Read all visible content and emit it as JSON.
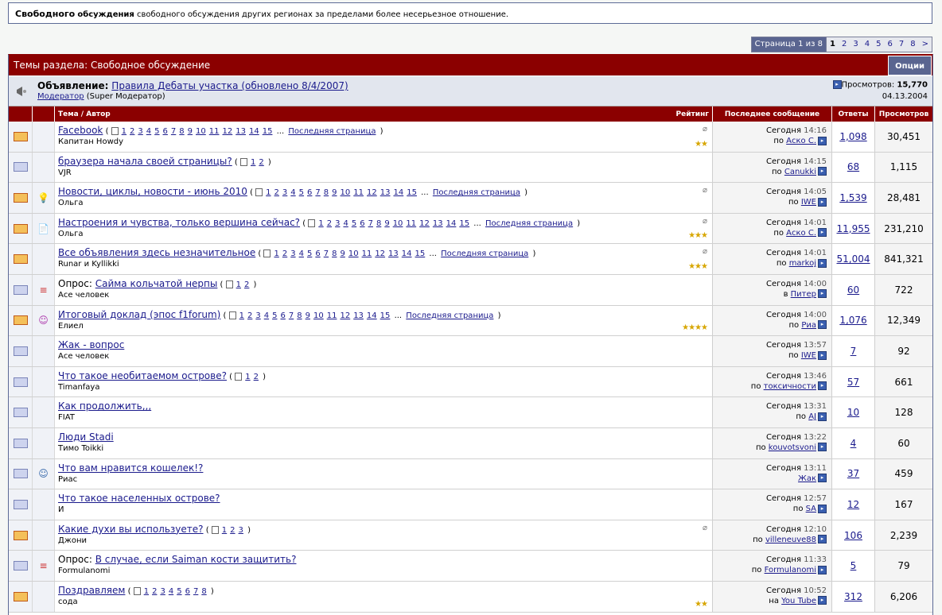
{
  "forum_desc": {
    "title": "Свободного",
    "bold2": "обсуждения",
    "text": " свободного обсуждения других регионах за пределами более несерьезное отношение."
  },
  "pager": {
    "info": "Страница 1 из 8",
    "current": "1",
    "pages": [
      "2",
      "3",
      "4",
      "5",
      "6",
      "7",
      "8"
    ],
    "next": ">"
  },
  "threads_header": {
    "title": "Темы раздела: Свободное обсуждение",
    "options": "Опции"
  },
  "announcement": {
    "label": "Объявление:",
    "link": "Правила Дебаты участка (обновлено 8/4/2007)",
    "author": "Модератор",
    "role": "(Super Модератор)",
    "views_label": "Просмотров:",
    "views": "15,770",
    "date": "04.13.2004"
  },
  "columns": {
    "topic": "Тема / Автор",
    "rating": "Рейтинг",
    "last": "Последнее сообщение",
    "replies": "Ответы",
    "views": "Просмотров"
  },
  "rows": [
    {
      "hot": true,
      "icon": "",
      "prefix": "",
      "title": "Facebook",
      "pages": "1 2 3 4 5 6 7 8 9 10 11 12 13 14 15",
      "last_page": "Последняя страница",
      "author": "Капитан Howdy",
      "time": "Сегодня",
      "hour": "14:16",
      "by": "по",
      "user": "Аско С.",
      "replies": "1,098",
      "views": "30,451",
      "stars": "★★",
      "clip": true
    },
    {
      "hot": false,
      "icon": "",
      "prefix": "",
      "title": "браузера начала своей страницы?",
      "pages": "1 2",
      "last_page": "",
      "author": "VJR",
      "time": "Сегодня",
      "hour": "14:15",
      "by": "по",
      "user": "Canukki",
      "replies": "68",
      "views": "1,115",
      "stars": "",
      "clip": false
    },
    {
      "hot": true,
      "icon": "bulb",
      "prefix": "",
      "title": "Новости, циклы, новости - июнь 2010",
      "pages": "1 2 3 4 5 6 7 8 9 10 11 12 13 14 15",
      "last_page": "Последняя страница",
      "author": "Ольга",
      "time": "Сегодня",
      "hour": "14:05",
      "by": "по",
      "user": "IWE",
      "replies": "1,539",
      "views": "28,481",
      "stars": "",
      "clip": true
    },
    {
      "hot": true,
      "icon": "note",
      "prefix": "",
      "title": "Настроения и чувства, только вершина сейчас?",
      "pages": "1 2 3 4 5 6 7 8 9 10 11 12 13 14 15",
      "last_page": "Последняя страница",
      "author": "Ольга",
      "time": "Сегодня",
      "hour": "14:01",
      "by": "по",
      "user": "Аско С.",
      "replies": "11,955",
      "views": "231,210",
      "stars": "★★★",
      "clip": true
    },
    {
      "hot": true,
      "icon": "",
      "prefix": "",
      "title": "Все объявления здесь незначительное",
      "pages": "1 2 3 4 5 6 7 8 9 10 11 12 13 14 15",
      "last_page": "Последняя страница",
      "author": "Runar и Kyllikki",
      "time": "Сегодня",
      "hour": "14:01",
      "by": "по",
      "user": "markoj",
      "replies": "51,004",
      "views": "841,321",
      "stars": "★★★",
      "clip": true
    },
    {
      "hot": false,
      "icon": "poll",
      "prefix": "Опрос: ",
      "title": "Сайма кольчатой нерпы",
      "pages": "1 2",
      "last_page": "",
      "author": "Асе человек",
      "time": "Сегодня",
      "hour": "14:00",
      "by": "в",
      "user": "Питер",
      "replies": "60",
      "views": "722",
      "stars": "",
      "clip": false
    },
    {
      "hot": true,
      "icon": "smile",
      "prefix": "",
      "title": "Итоговый доклад (эпос f1forum)",
      "pages": "1 2 3 4 5 6 7 8 9 10 11 12 13 14 15",
      "last_page": "Последняя страница",
      "author": "Елиел",
      "time": "Сегодня",
      "hour": "14:00",
      "by": "по",
      "user": "Риа",
      "replies": "1,076",
      "views": "12,349",
      "stars": "★★★★",
      "clip": false
    },
    {
      "hot": false,
      "icon": "",
      "prefix": "",
      "title": "Жак - вопрос",
      "pages": "",
      "last_page": "",
      "author": "Асе человек",
      "time": "Сегодня",
      "hour": "13:57",
      "by": "по",
      "user": "IWE",
      "replies": "7",
      "views": "92",
      "stars": "",
      "clip": false
    },
    {
      "hot": false,
      "icon": "",
      "prefix": "",
      "title": "Что такое необитаемом острове?",
      "pages": "1 2",
      "last_page": "",
      "author": "Timanfaya",
      "time": "Сегодня",
      "hour": "13:46",
      "by": "по",
      "user": "токсичности",
      "replies": "57",
      "views": "661",
      "stars": "",
      "clip": false
    },
    {
      "hot": false,
      "icon": "",
      "prefix": "",
      "title": "Как продолжить,,,",
      "pages": "",
      "last_page": "",
      "author": "FIAT",
      "time": "Сегодня",
      "hour": "13:31",
      "by": "по",
      "user": "AJ",
      "replies": "10",
      "views": "128",
      "stars": "",
      "clip": false
    },
    {
      "hot": false,
      "icon": "",
      "prefix": "",
      "title": "Люди Stadi",
      "pages": "",
      "last_page": "",
      "author": "Тимо Toikki",
      "time": "Сегодня",
      "hour": "13:22",
      "by": "по",
      "user": "kouvotsvoni",
      "replies": "4",
      "views": "60",
      "stars": "",
      "clip": false
    },
    {
      "hot": false,
      "icon": "wink",
      "prefix": "",
      "title": "Что вам нравится кошелек!?",
      "pages": "",
      "last_page": "",
      "author": "Риас",
      "time": "Сегодня",
      "hour": "13:11",
      "by": "",
      "user": "Жак",
      "replies": "37",
      "views": "459",
      "stars": "",
      "clip": false
    },
    {
      "hot": false,
      "icon": "",
      "prefix": "",
      "title": "Что такое населенных острове?",
      "pages": "",
      "last_page": "",
      "author": "И",
      "time": "Сегодня",
      "hour": "12:57",
      "by": "по",
      "user": "SA",
      "replies": "12",
      "views": "167",
      "stars": "",
      "clip": false
    },
    {
      "hot": true,
      "icon": "",
      "prefix": "",
      "title": "Какие духи вы используете?",
      "pages": "1 2 3",
      "last_page": "",
      "author": "Джони",
      "time": "Сегодня",
      "hour": "12:10",
      "by": "по",
      "user": "villeneuve88",
      "replies": "106",
      "views": "2,239",
      "stars": "",
      "clip": true
    },
    {
      "hot": false,
      "icon": "poll",
      "prefix": "Опрос: ",
      "title": "В случае, если Saiman кости защитить?",
      "pages": "",
      "last_page": "",
      "author": "Formulanomi",
      "time": "Сегодня",
      "hour": "11:33",
      "by": "по",
      "user": "Formulanomi",
      "replies": "5",
      "views": "79",
      "stars": "",
      "clip": false
    },
    {
      "hot": true,
      "icon": "",
      "prefix": "",
      "title": "Поздравляем",
      "pages": "1 2 3 4 5 6 7 8",
      "last_page": "",
      "author": "сода",
      "time": "Сегодня",
      "hour": "10:52",
      "by": "на",
      "user": "You Tube",
      "replies": "312",
      "views": "6,206",
      "stars": "★★",
      "clip": false
    }
  ]
}
